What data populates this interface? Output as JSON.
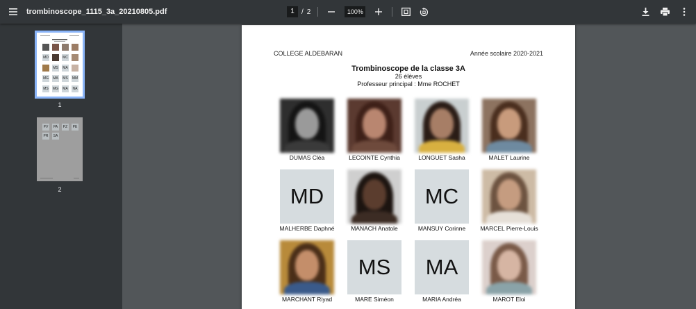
{
  "toolbar": {
    "title": "trombinoscope_1115_3a_20210805.pdf",
    "current_page": "1",
    "page_separator": "/",
    "total_pages": "2",
    "zoom": "100%"
  },
  "sidebar": {
    "thumbnails": [
      {
        "label": "1",
        "selected": true
      },
      {
        "label": "2",
        "selected": false
      }
    ],
    "page2_mini_initials": [
      "PV",
      "PA",
      "PZ",
      "PE",
      "PR",
      "SA"
    ],
    "page1_mini_initials": [
      "MD",
      "MC",
      "MS",
      "MA",
      "MG",
      "MA",
      "MS",
      "MM",
      "NA",
      "MS",
      "MG",
      "MA"
    ]
  },
  "document": {
    "school": "COLLEGE ALDEBARAN",
    "year": "Année scolaire 2020-2021",
    "title": "Trombinoscope de la classe 3A",
    "count": "26 élèves",
    "teacher": "Professeur principal : Mme ROCHET",
    "students": [
      {
        "name": "DUMAS Cléa",
        "initials": "",
        "photo": "bw"
      },
      {
        "name": "LECOINTE Cynthia",
        "initials": "",
        "photo": "warm"
      },
      {
        "name": "LONGUET Sasha",
        "initials": "",
        "photo": "light"
      },
      {
        "name": "MALET Laurine",
        "initials": "",
        "photo": "tan"
      },
      {
        "name": "MALHERBE Daphné",
        "initials": "MD",
        "photo": ""
      },
      {
        "name": "MANACH Anatole",
        "initials": "",
        "photo": "dark"
      },
      {
        "name": "MANSUY Corinne",
        "initials": "MC",
        "photo": ""
      },
      {
        "name": "MARCEL Pierre-Louis",
        "initials": "",
        "photo": "beige"
      },
      {
        "name": "MARCHANT Riyad",
        "initials": "",
        "photo": "golden"
      },
      {
        "name": "MARE Siméon",
        "initials": "MS",
        "photo": ""
      },
      {
        "name": "MARIA Andréa",
        "initials": "MA",
        "photo": ""
      },
      {
        "name": "MAROT Eloi",
        "initials": "",
        "photo": "pale"
      }
    ]
  },
  "colors": {
    "toolbar_bg": "#323639",
    "viewer_bg": "#525659",
    "thumb_selected": "#8ab4f8",
    "initials_bg": "#d6dcdf"
  }
}
